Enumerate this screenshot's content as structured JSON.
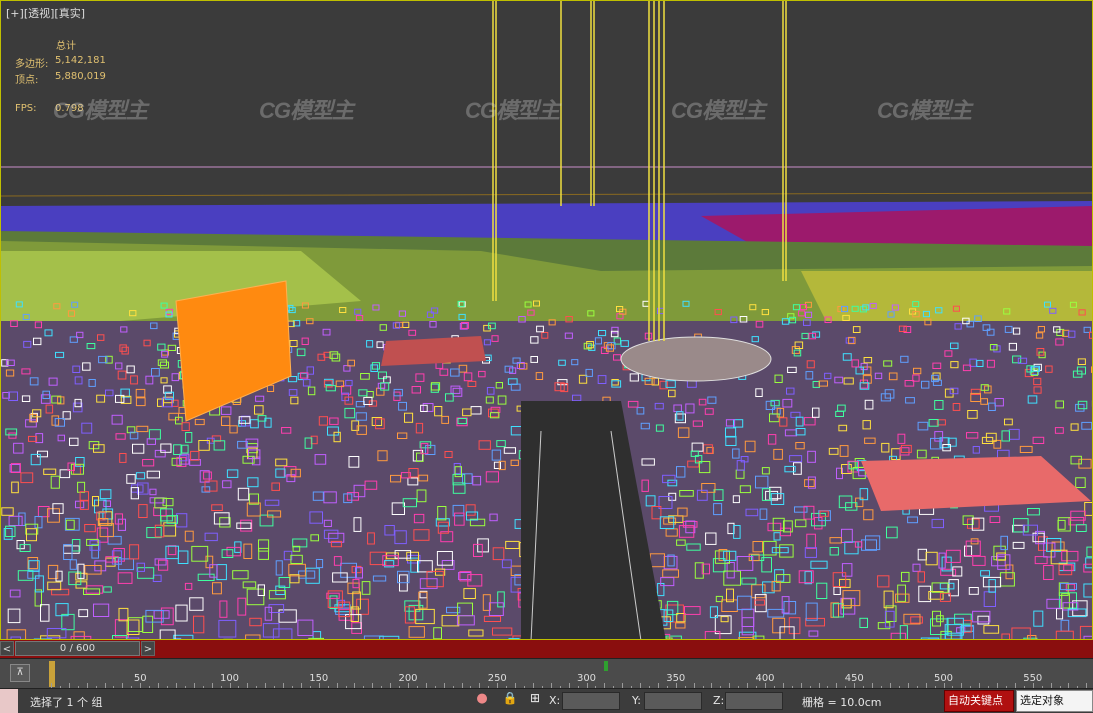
{
  "viewport": {
    "label_plus": "[+]",
    "label_view": "[透视]",
    "label_shading": "[真实]"
  },
  "stats": {
    "total_label": "总计",
    "polygons_label": "多边形:",
    "polygons_value": "5,142,181",
    "vertices_label": "顶点:",
    "vertices_value": "5,880,019",
    "fps_label": "FPS:",
    "fps_value": "0.798"
  },
  "watermark": "CG模型主",
  "timeline": {
    "frame_display": "0 / 600",
    "prev_arrow": "<",
    "next_arrow": ">",
    "ticks": [
      "50",
      "100",
      "150",
      "200",
      "250",
      "300",
      "350",
      "400",
      "450",
      "500",
      "550"
    ]
  },
  "statusbar": {
    "selection_text": "选择了 1 个 组",
    "x_label": "X:",
    "y_label": "Y:",
    "z_label": "Z:",
    "grid_text": "栅格 = 10.0cm",
    "auto_key_label": "自动关键点",
    "selected_objects_label": "选定对象"
  },
  "colors": {
    "time_bar": "#8a0e0e",
    "stats_text": "#e0c070",
    "auto_key": "#b01010",
    "viewport_border": "#bfbf00"
  }
}
